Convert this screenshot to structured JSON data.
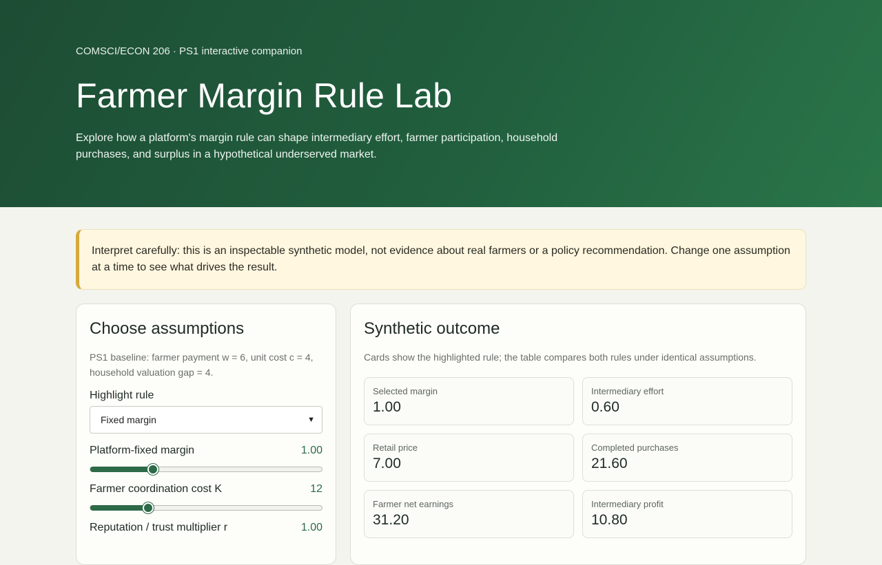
{
  "hero": {
    "kicker": "COMSCI/ECON 206 · PS1 interactive companion",
    "title": "Farmer Margin Rule Lab",
    "lead": "Explore how a platform's margin rule can shape intermediary effort, farmer participation, household purchases, and surplus in a hypothetical underserved market."
  },
  "notice": {
    "text": "Interpret carefully: this is an inspectable synthetic model, not evidence about real farmers or a policy recommendation. Change one assumption at a time to see what drives the result."
  },
  "assumptions": {
    "title": "Choose assumptions",
    "baseline": "PS1 baseline: farmer payment w = 6, unit cost c = 4, household valuation gap = 4.",
    "rule_label": "Highlight rule",
    "rule_selected": "Fixed margin",
    "sliders": [
      {
        "label": "Platform-fixed margin",
        "value": "1.00",
        "fraction": 0.27
      },
      {
        "label": "Farmer coordination cost K",
        "value": "12",
        "fraction": 0.25
      },
      {
        "label": "Reputation / trust multiplier r",
        "value": "1.00"
      }
    ]
  },
  "outcome": {
    "title": "Synthetic outcome",
    "subtitle": "Cards show the highlighted rule; the table compares both rules under identical assumptions.",
    "cards": [
      {
        "label": "Selected margin",
        "value": "1.00"
      },
      {
        "label": "Intermediary effort",
        "value": "0.60"
      },
      {
        "label": "Retail price",
        "value": "7.00"
      },
      {
        "label": "Completed purchases",
        "value": "21.60"
      },
      {
        "label": "Farmer net earnings",
        "value": "31.20"
      },
      {
        "label": "Intermediary profit",
        "value": "10.80"
      }
    ]
  },
  "colors": {
    "accent": "#2d6a47",
    "hero_bg": "#1d4d34",
    "notice_border": "#d7a93a"
  }
}
